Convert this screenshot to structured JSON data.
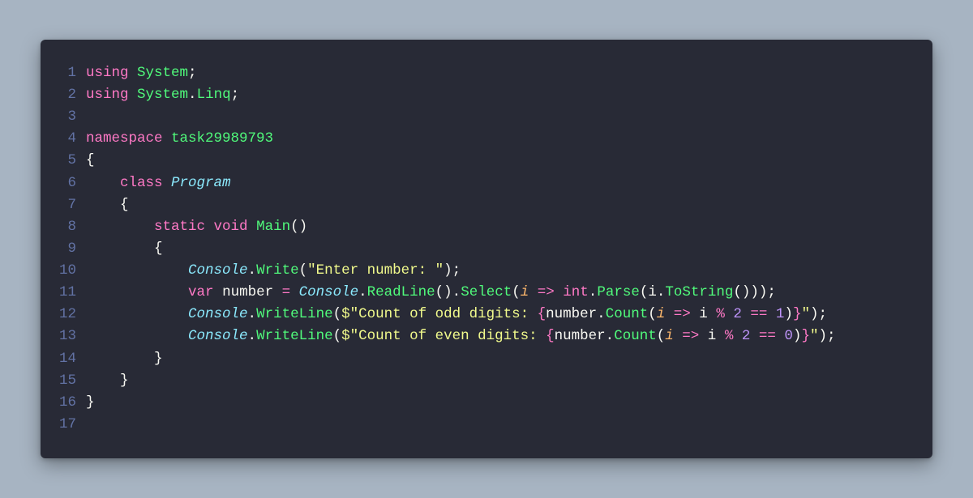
{
  "colors": {
    "page_bg": "#a7b4c2",
    "editor_bg": "#282a36",
    "lineno": "#6272a4",
    "plain": "#f8f8f2",
    "keyword": "#ff79c6",
    "type": "#8be9fd",
    "function": "#50fa7b",
    "string": "#f1fa8c",
    "param": "#ffb86c",
    "number": "#bd93f9"
  },
  "code": {
    "language": "csharp",
    "line_count": 17,
    "lines": [
      {
        "n": 1,
        "tokens": [
          {
            "t": "using",
            "c": "kw"
          },
          {
            "t": " ",
            "c": "plain"
          },
          {
            "t": "System",
            "c": "ns"
          },
          {
            "t": ";",
            "c": "pn"
          }
        ]
      },
      {
        "n": 2,
        "tokens": [
          {
            "t": "using",
            "c": "kw"
          },
          {
            "t": " ",
            "c": "plain"
          },
          {
            "t": "System",
            "c": "ns"
          },
          {
            "t": ".",
            "c": "pn"
          },
          {
            "t": "Linq",
            "c": "ns"
          },
          {
            "t": ";",
            "c": "pn"
          }
        ]
      },
      {
        "n": 3,
        "tokens": []
      },
      {
        "n": 4,
        "tokens": [
          {
            "t": "namespace",
            "c": "kw"
          },
          {
            "t": " ",
            "c": "plain"
          },
          {
            "t": "task29989793",
            "c": "ns"
          }
        ]
      },
      {
        "n": 5,
        "tokens": [
          {
            "t": "{",
            "c": "pn"
          }
        ]
      },
      {
        "n": 6,
        "tokens": [
          {
            "t": "    ",
            "c": "plain"
          },
          {
            "t": "class",
            "c": "kw"
          },
          {
            "t": " ",
            "c": "plain"
          },
          {
            "t": "Program",
            "c": "type"
          }
        ]
      },
      {
        "n": 7,
        "tokens": [
          {
            "t": "    {",
            "c": "pn"
          }
        ]
      },
      {
        "n": 8,
        "tokens": [
          {
            "t": "        ",
            "c": "plain"
          },
          {
            "t": "static",
            "c": "kw"
          },
          {
            "t": " ",
            "c": "plain"
          },
          {
            "t": "void",
            "c": "kw"
          },
          {
            "t": " ",
            "c": "plain"
          },
          {
            "t": "Main",
            "c": "fn"
          },
          {
            "t": "()",
            "c": "pn"
          }
        ]
      },
      {
        "n": 9,
        "tokens": [
          {
            "t": "        {",
            "c": "pn"
          }
        ]
      },
      {
        "n": 10,
        "tokens": [
          {
            "t": "            ",
            "c": "plain"
          },
          {
            "t": "Console",
            "c": "type"
          },
          {
            "t": ".",
            "c": "pn"
          },
          {
            "t": "Write",
            "c": "fn"
          },
          {
            "t": "(",
            "c": "pn"
          },
          {
            "t": "\"Enter number: \"",
            "c": "str"
          },
          {
            "t": ");",
            "c": "pn"
          }
        ]
      },
      {
        "n": 11,
        "tokens": [
          {
            "t": "            ",
            "c": "plain"
          },
          {
            "t": "var",
            "c": "kw"
          },
          {
            "t": " ",
            "c": "plain"
          },
          {
            "t": "number",
            "c": "plain"
          },
          {
            "t": " ",
            "c": "plain"
          },
          {
            "t": "=",
            "c": "op"
          },
          {
            "t": " ",
            "c": "plain"
          },
          {
            "t": "Console",
            "c": "type"
          },
          {
            "t": ".",
            "c": "pn"
          },
          {
            "t": "ReadLine",
            "c": "fn"
          },
          {
            "t": "().",
            "c": "pn"
          },
          {
            "t": "Select",
            "c": "fn"
          },
          {
            "t": "(",
            "c": "pn"
          },
          {
            "t": "i",
            "c": "pm"
          },
          {
            "t": " ",
            "c": "plain"
          },
          {
            "t": "=>",
            "c": "op"
          },
          {
            "t": " ",
            "c": "plain"
          },
          {
            "t": "int",
            "c": "kw"
          },
          {
            "t": ".",
            "c": "pn"
          },
          {
            "t": "Parse",
            "c": "fn"
          },
          {
            "t": "(",
            "c": "pn"
          },
          {
            "t": "i",
            "c": "plain"
          },
          {
            "t": ".",
            "c": "pn"
          },
          {
            "t": "ToString",
            "c": "fn"
          },
          {
            "t": "()));",
            "c": "pn"
          }
        ]
      },
      {
        "n": 12,
        "tokens": [
          {
            "t": "            ",
            "c": "plain"
          },
          {
            "t": "Console",
            "c": "type"
          },
          {
            "t": ".",
            "c": "pn"
          },
          {
            "t": "WriteLine",
            "c": "fn"
          },
          {
            "t": "(",
            "c": "pn"
          },
          {
            "t": "$\"Count of odd digits: ",
            "c": "str"
          },
          {
            "t": "{",
            "c": "op"
          },
          {
            "t": "number",
            "c": "plain"
          },
          {
            "t": ".",
            "c": "pn"
          },
          {
            "t": "Count",
            "c": "fn"
          },
          {
            "t": "(",
            "c": "pn"
          },
          {
            "t": "i",
            "c": "pm"
          },
          {
            "t": " ",
            "c": "plain"
          },
          {
            "t": "=>",
            "c": "op"
          },
          {
            "t": " ",
            "c": "plain"
          },
          {
            "t": "i",
            "c": "plain"
          },
          {
            "t": " ",
            "c": "plain"
          },
          {
            "t": "%",
            "c": "op"
          },
          {
            "t": " ",
            "c": "plain"
          },
          {
            "t": "2",
            "c": "num"
          },
          {
            "t": " ",
            "c": "plain"
          },
          {
            "t": "==",
            "c": "op"
          },
          {
            "t": " ",
            "c": "plain"
          },
          {
            "t": "1",
            "c": "num"
          },
          {
            "t": ")",
            "c": "pn"
          },
          {
            "t": "}",
            "c": "op"
          },
          {
            "t": "\"",
            "c": "str"
          },
          {
            "t": ");",
            "c": "pn"
          }
        ]
      },
      {
        "n": 13,
        "tokens": [
          {
            "t": "            ",
            "c": "plain"
          },
          {
            "t": "Console",
            "c": "type"
          },
          {
            "t": ".",
            "c": "pn"
          },
          {
            "t": "WriteLine",
            "c": "fn"
          },
          {
            "t": "(",
            "c": "pn"
          },
          {
            "t": "$\"Count of even digits: ",
            "c": "str"
          },
          {
            "t": "{",
            "c": "op"
          },
          {
            "t": "number",
            "c": "plain"
          },
          {
            "t": ".",
            "c": "pn"
          },
          {
            "t": "Count",
            "c": "fn"
          },
          {
            "t": "(",
            "c": "pn"
          },
          {
            "t": "i",
            "c": "pm"
          },
          {
            "t": " ",
            "c": "plain"
          },
          {
            "t": "=>",
            "c": "op"
          },
          {
            "t": " ",
            "c": "plain"
          },
          {
            "t": "i",
            "c": "plain"
          },
          {
            "t": " ",
            "c": "plain"
          },
          {
            "t": "%",
            "c": "op"
          },
          {
            "t": " ",
            "c": "plain"
          },
          {
            "t": "2",
            "c": "num"
          },
          {
            "t": " ",
            "c": "plain"
          },
          {
            "t": "==",
            "c": "op"
          },
          {
            "t": " ",
            "c": "plain"
          },
          {
            "t": "0",
            "c": "num"
          },
          {
            "t": ")",
            "c": "pn"
          },
          {
            "t": "}",
            "c": "op"
          },
          {
            "t": "\"",
            "c": "str"
          },
          {
            "t": ");",
            "c": "pn"
          }
        ]
      },
      {
        "n": 14,
        "tokens": [
          {
            "t": "        }",
            "c": "pn"
          }
        ]
      },
      {
        "n": 15,
        "tokens": [
          {
            "t": "    }",
            "c": "pn"
          }
        ]
      },
      {
        "n": 16,
        "tokens": [
          {
            "t": "}",
            "c": "pn"
          }
        ]
      },
      {
        "n": 17,
        "tokens": []
      }
    ]
  }
}
